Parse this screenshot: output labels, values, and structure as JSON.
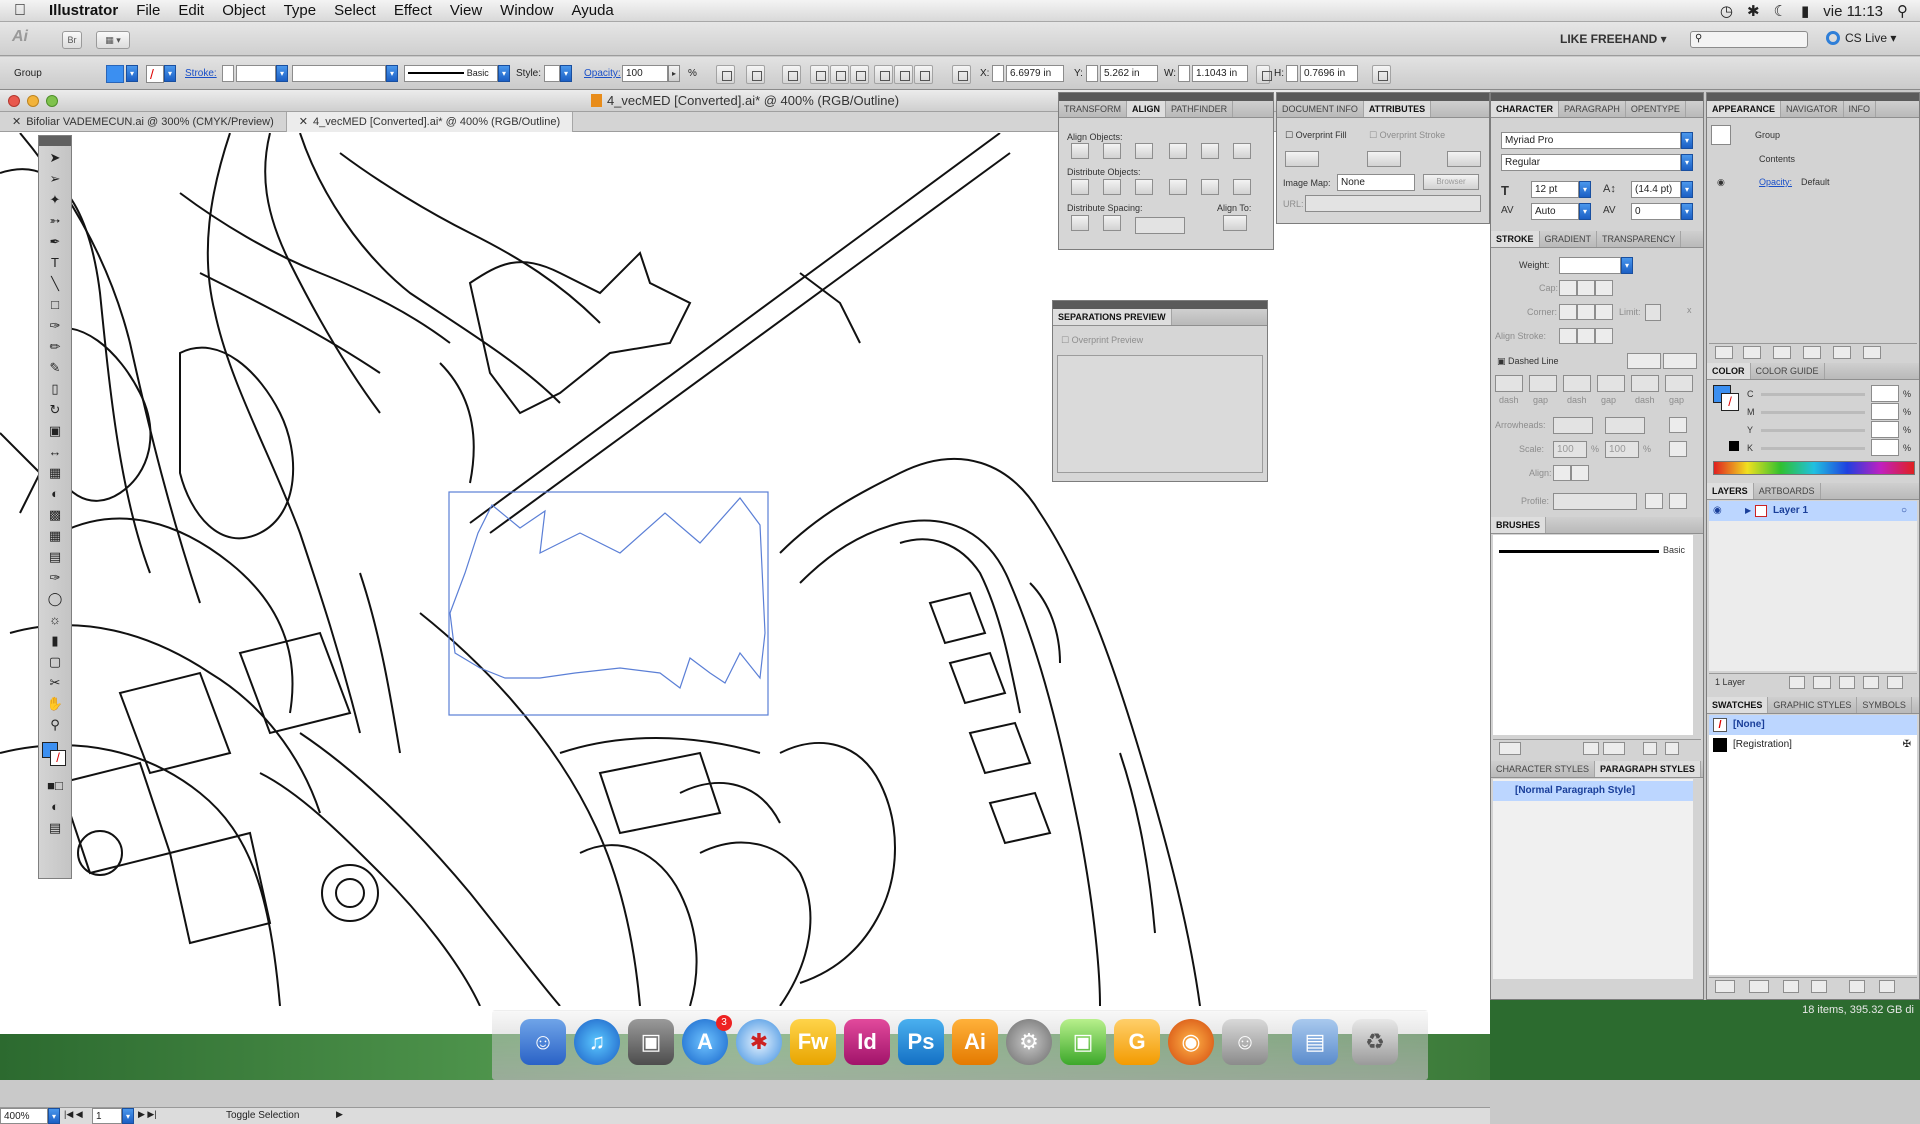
{
  "menubar": {
    "app": "Illustrator",
    "items": [
      "File",
      "Edit",
      "Object",
      "Type",
      "Select",
      "Effect",
      "View",
      "Window",
      "Ayuda"
    ],
    "clock": "vie 11:13"
  },
  "appbar": {
    "br": "Br",
    "workspace": "LIKE FREEHAND ▾",
    "cslive": "CS Live ▾"
  },
  "control": {
    "selection": "Group",
    "stroke_label": "Stroke:",
    "brush": "Basic",
    "style_label": "Style:",
    "opacity_label": "Opacity:",
    "opacity_value": "100",
    "percent": "%",
    "x_label": "X:",
    "x_value": "6.6979 in",
    "y_label": "Y:",
    "y_value": "5.262 in",
    "w_label": "W:",
    "w_value": "1.1043 in",
    "h_label": "H:",
    "h_value": "0.7696 in"
  },
  "document": {
    "title": "4_vecMED [Converted].ai* @ 400% (RGB/Outline)",
    "tabs": [
      "Bifoliar VADEMECUN.ai @ 300% (CMYK/Preview)",
      "4_vecMED [Converted].ai* @ 400% (RGB/Outline)"
    ],
    "zoom": "400%",
    "page": "1",
    "status": "Toggle Selection"
  },
  "align_panel": {
    "tabs": [
      "TRANSFORM",
      "ALIGN",
      "PATHFINDER"
    ],
    "align_objects": "Align Objects:",
    "distribute_objects": "Distribute Objects:",
    "distribute_spacing": "Distribute Spacing:",
    "align_to": "Align To:"
  },
  "docinfo_panel": {
    "tabs": [
      "DOCUMENT INFO",
      "ATTRIBUTES"
    ],
    "overprint_fill": "Overprint Fill",
    "overprint_stroke": "Overprint Stroke",
    "image_map": "Image Map:",
    "image_map_value": "None",
    "browser": "Browser",
    "url": "URL:"
  },
  "separations": {
    "title": "SEPARATIONS PREVIEW",
    "overprint_preview": "Overprint Preview"
  },
  "character_panel": {
    "tabs": [
      "CHARACTER",
      "PARAGRAPH",
      "OPENTYPE"
    ],
    "font": "Myriad Pro",
    "style": "Regular",
    "size": "12 pt",
    "leading": "(14.4 pt)",
    "kerning": "Auto",
    "tracking": "0"
  },
  "stroke_panel": {
    "tabs": [
      "STROKE",
      "GRADIENT",
      "TRANSPARENCY"
    ],
    "weight": "Weight:",
    "cap": "Cap:",
    "corner": "Corner:",
    "limit": "Limit:",
    "limit_x": "x",
    "align_stroke": "Align Stroke:",
    "dashed_line": "Dashed Line",
    "dash": "dash",
    "gap": "gap",
    "arrowheads": "Arrowheads:",
    "scale": "Scale:",
    "scale_value_1": "100",
    "scale_value_2": "100",
    "percent": "%",
    "align": "Align:",
    "profile": "Profile:"
  },
  "brushes_panel": {
    "title": "BRUSHES",
    "brush": "Basic"
  },
  "paragraph_styles": {
    "tabs": [
      "CHARACTER STYLES",
      "PARAGRAPH STYLES"
    ],
    "item": "[Normal Paragraph Style]"
  },
  "appearance_panel": {
    "tabs": [
      "APPEARANCE",
      "NAVIGATOR",
      "INFO"
    ],
    "group": "Group",
    "contents": "Contents",
    "opacity_label": "Opacity:",
    "opacity_value": "Default"
  },
  "color_panel": {
    "tabs": [
      "COLOR",
      "COLOR GUIDE"
    ],
    "channels": [
      "C",
      "M",
      "Y",
      "K"
    ],
    "percent": "%"
  },
  "layers_panel": {
    "tabs": [
      "LAYERS",
      "ARTBOARDS"
    ],
    "layer": "Layer 1",
    "count": "1 Layer"
  },
  "swatches_panel": {
    "tabs": [
      "SWATCHES",
      "GRAPHIC STYLES",
      "SYMBOLS"
    ],
    "items": [
      "[None]",
      "[Registration]"
    ]
  },
  "desktop": {
    "disk": "18 items, 395.32 GB di"
  },
  "dock": {
    "badge": "3",
    "labels": [
      "Fw",
      "Id",
      "Ps",
      "Ai"
    ]
  },
  "colors": {
    "accent": "#3b8ff1",
    "selection": "#5b7fd6"
  }
}
